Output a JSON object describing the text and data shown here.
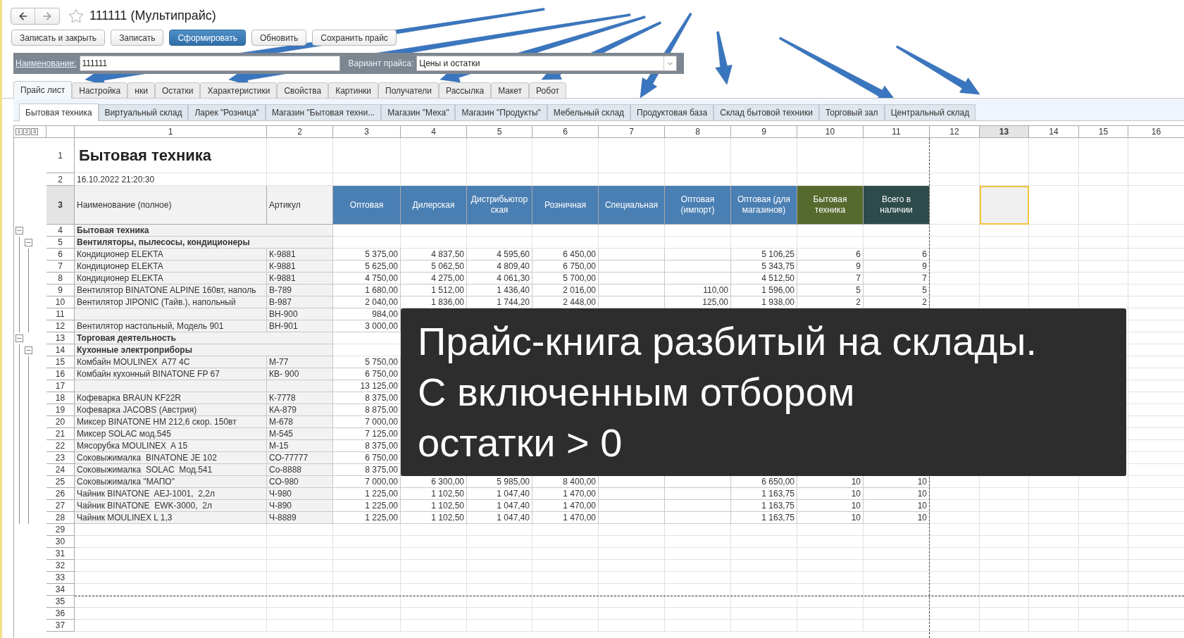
{
  "window": {
    "title": "111111 (Мультипрайс)",
    "favorite": false
  },
  "toolbar_buttons": [
    {
      "label": "Записать и закрыть",
      "kind": "default"
    },
    {
      "label": "Записать",
      "kind": "default"
    },
    {
      "label": "Сформировать",
      "kind": "primary"
    },
    {
      "label": "Обновить",
      "kind": "default"
    },
    {
      "label": "Сохранить прайс",
      "kind": "default"
    }
  ],
  "form": {
    "name_label": "Наименование:",
    "name_value": "111111",
    "variant_label": "Вариант прайса:",
    "variant_value": "Цены и остатки"
  },
  "tabs": [
    {
      "label": "Прайс лист",
      "selected": true
    },
    {
      "label": "Настройка",
      "selected": false
    },
    {
      "label": "нки",
      "selected": false
    },
    {
      "label": "Остатки",
      "selected": false
    },
    {
      "label": "Характеристики",
      "selected": false
    },
    {
      "label": "Свойства",
      "selected": false
    },
    {
      "label": "Картинки",
      "selected": false
    },
    {
      "label": "Получатели",
      "selected": false
    },
    {
      "label": "Рассылка",
      "selected": false
    },
    {
      "label": "Макет",
      "selected": false
    },
    {
      "label": "Робот",
      "selected": false
    }
  ],
  "warehouse_tabs": [
    {
      "label": "Бытовая техника",
      "selected": true
    },
    {
      "label": "Виртуальный склад",
      "selected": false
    },
    {
      "label": "Ларек \"Розница\"",
      "selected": false
    },
    {
      "label": "Магазин \"Бытовая техни...",
      "selected": false
    },
    {
      "label": "Магазин \"Меха\"",
      "selected": false
    },
    {
      "label": "Магазин \"Продукты\"",
      "selected": false
    },
    {
      "label": "Мебельный склад",
      "selected": false
    },
    {
      "label": "Продуктовая база",
      "selected": false
    },
    {
      "label": "Склад бытовой техники",
      "selected": false
    },
    {
      "label": "Торговый зал",
      "selected": false
    },
    {
      "label": "Центральный склад",
      "selected": false
    }
  ],
  "sheet": {
    "outline_levels": [
      "1",
      "2",
      "3"
    ],
    "columns": [
      {
        "label": "1",
        "selected": false
      },
      {
        "label": "2",
        "selected": false
      },
      {
        "label": "3",
        "selected": false
      },
      {
        "label": "4",
        "selected": false
      },
      {
        "label": "5",
        "selected": false
      },
      {
        "label": "6",
        "selected": false
      },
      {
        "label": "7",
        "selected": false
      },
      {
        "label": "8",
        "selected": false
      },
      {
        "label": "9",
        "selected": false
      },
      {
        "label": "10",
        "selected": false
      },
      {
        "label": "11",
        "selected": false
      },
      {
        "label": "12",
        "selected": false
      },
      {
        "label": "13",
        "selected": true
      },
      {
        "label": "14",
        "selected": false
      },
      {
        "label": "15",
        "selected": false
      },
      {
        "label": "16",
        "selected": false
      }
    ],
    "title_row": {
      "number": "1",
      "text": "Бытовая техника"
    },
    "date_row": {
      "number": "2",
      "text": "16.10.2022 21:20:30"
    },
    "header_row": {
      "number": "3",
      "selected": true,
      "cells": [
        {
          "text": "Наименование (полное)",
          "kind": "plain"
        },
        {
          "text": "Артикул",
          "kind": "plain"
        },
        {
          "text": "Оптовая",
          "kind": "price"
        },
        {
          "text": "Дилерская",
          "kind": "price"
        },
        {
          "text": "Дистрибьютор ская",
          "kind": "price"
        },
        {
          "text": "Розничная",
          "kind": "price"
        },
        {
          "text": "Специальная",
          "kind": "price"
        },
        {
          "text": "Оптовая (импорт)",
          "kind": "price"
        },
        {
          "text": "Оптовая (для магазинов)",
          "kind": "price"
        },
        {
          "text": "Бытовая техника",
          "kind": "stock"
        },
        {
          "text": "Всего в наличии",
          "kind": "total"
        }
      ]
    },
    "rows": [
      {
        "number": "4",
        "title": "Бытовая техника",
        "expanded": true,
        "children": [
          {
            "number": "5",
            "title": "Вентиляторы, пылесосы, кондиционеры",
            "expanded": true,
            "children": [
              {
                "number": "6",
                "cells": [
                  "Кондиционер ELEKTA",
                  "К-9881",
                  "5 375,00",
                  "4 837,50",
                  "4 595,60",
                  "6 450,00",
                  null,
                  null,
                  "5 106,25",
                  "6",
                  "6"
                ]
              },
              {
                "number": "7",
                "cells": [
                  "Кондиционер ELEKTA",
                  "К-9881",
                  "5 625,00",
                  "5 062,50",
                  "4 809,40",
                  "6 750,00",
                  null,
                  null,
                  "5 343,75",
                  "9",
                  "9"
                ]
              },
              {
                "number": "8",
                "cells": [
                  "Кондиционер ELEKTA",
                  "К-9881",
                  "4 750,00",
                  "4 275,00",
                  "4 061,30",
                  "5 700,00",
                  null,
                  null,
                  "4 512,50",
                  "7",
                  "7"
                ]
              },
              {
                "number": "9",
                "cells": [
                  "Вентилятор BINATONE ALPINE 160вт, наполь",
                  "В-789",
                  "1 680,00",
                  "1 512,00",
                  "1 436,40",
                  "2 016,00",
                  null,
                  "110,00",
                  "1 596,00",
                  "5",
                  "5"
                ]
              },
              {
                "number": "10",
                "cells": [
                  "Вентилятор JIPONIC (Тайв.), напольный",
                  "В-987",
                  "2 040,00",
                  "1 836,00",
                  "1 744,20",
                  "2 448,00",
                  null,
                  "125,00",
                  "1 938,00",
                  "2",
                  "2"
                ]
              },
              {
                "number": "11",
                "cells": [
                  null,
                  "ВН-900",
                  "984,00",
                  null,
                  null,
                  null,
                  null,
                  null,
                  null,
                  null,
                  null
                ]
              },
              {
                "number": "12",
                "cells": [
                  "Вентилятор настольный, Модель 901",
                  "ВН-901",
                  "3 000,00",
                  null,
                  null,
                  null,
                  null,
                  null,
                  null,
                  null,
                  null
                ]
              }
            ]
          }
        ]
      },
      {
        "number": "13",
        "title": "Торговая деятельность",
        "expanded": true,
        "children": [
          {
            "number": "14",
            "title": "Кухонные электроприборы",
            "expanded": true,
            "children": [
              {
                "number": "15",
                "cells": [
                  "Комбайн MOULINEX  A77 4C",
                  "М-77",
                  "5 750,00",
                  null,
                  null,
                  null,
                  null,
                  null,
                  null,
                  null,
                  null
                ]
              },
              {
                "number": "16",
                "cells": [
                  "Комбайн кухонный BINATONE FP 67",
                  "КВ- 900",
                  "6 750,00",
                  null,
                  null,
                  null,
                  null,
                  null,
                  null,
                  null,
                  null
                ]
              },
              {
                "number": "17",
                "cells": [
                  null,
                  null,
                  "13 125,00",
                  null,
                  null,
                  null,
                  null,
                  null,
                  null,
                  null,
                  null
                ]
              },
              {
                "number": "18",
                "cells": [
                  "Кофеварка BRAUN KF22R",
                  "К-7778",
                  "8 375,00",
                  null,
                  null,
                  null,
                  null,
                  null,
                  null,
                  null,
                  null
                ]
              },
              {
                "number": "19",
                "cells": [
                  "Кофеварка JACOBS (Австрия)",
                  "КА-879",
                  "8 875,00",
                  null,
                  null,
                  null,
                  null,
                  null,
                  null,
                  null,
                  null
                ]
              },
              {
                "number": "20",
                "cells": [
                  "Миксер BINATONE HM 212,6 скор. 150вт",
                  "М-678",
                  "7 000,00",
                  null,
                  null,
                  null,
                  null,
                  null,
                  null,
                  null,
                  null
                ]
              },
              {
                "number": "21",
                "cells": [
                  "Миксер SOLAC мод.545",
                  "М-545",
                  "7 125,00",
                  null,
                  null,
                  null,
                  null,
                  null,
                  null,
                  null,
                  null
                ]
              },
              {
                "number": "22",
                "cells": [
                  "Мясорубка MOULINEX  A 15",
                  "М-15",
                  "8 375,00",
                  null,
                  null,
                  null,
                  null,
                  null,
                  null,
                  null,
                  null
                ]
              },
              {
                "number": "23",
                "cells": [
                  "Соковыжималка  BINATONE JE 102",
                  "СО-77777",
                  "6 750,00",
                  null,
                  null,
                  null,
                  null,
                  null,
                  null,
                  null,
                  null
                ]
              },
              {
                "number": "24",
                "cells": [
                  "Соковыжималка  SOLAC  Мод.541",
                  "Со-8888",
                  "8 375,00",
                  null,
                  null,
                  null,
                  null,
                  null,
                  null,
                  null,
                  null
                ]
              },
              {
                "number": "25",
                "cells": [
                  "Соковыжималка \"МАПО\"",
                  "СО-980",
                  "7 000,00",
                  "6 300,00",
                  "5 985,00",
                  "8 400,00",
                  null,
                  null,
                  "6 650,00",
                  "10",
                  "10"
                ]
              },
              {
                "number": "26",
                "cells": [
                  "Чайник BINATONE  AEJ-1001,  2,2л",
                  "Ч-980",
                  "1 225,00",
                  "1 102,50",
                  "1 047,40",
                  "1 470,00",
                  null,
                  null,
                  "1 163,75",
                  "10",
                  "10"
                ]
              },
              {
                "number": "27",
                "cells": [
                  "Чайник BINATONE  EWK-3000,  2л",
                  "Ч-890",
                  "1 225,00",
                  "1 102,50",
                  "1 047,40",
                  "1 470,00",
                  null,
                  null,
                  "1 163,75",
                  "10",
                  "10"
                ]
              },
              {
                "number": "28",
                "cells": [
                  "Чайник MOULINEX L 1,3",
                  "Ч-8889",
                  "1 225,00",
                  "1 102,50",
                  "1 047,40",
                  "1 470,00",
                  null,
                  null,
                  "1 163,75",
                  "10",
                  "10"
                ]
              }
            ]
          }
        ]
      }
    ],
    "empty_rows": [
      "29",
      "30",
      "31",
      "32",
      "33",
      "34",
      "35",
      "36",
      "37"
    ]
  },
  "caption": {
    "lines": [
      "Прайс-книга разбитый на склады.",
      "С включенным отбором",
      "остатки > 0"
    ]
  }
}
